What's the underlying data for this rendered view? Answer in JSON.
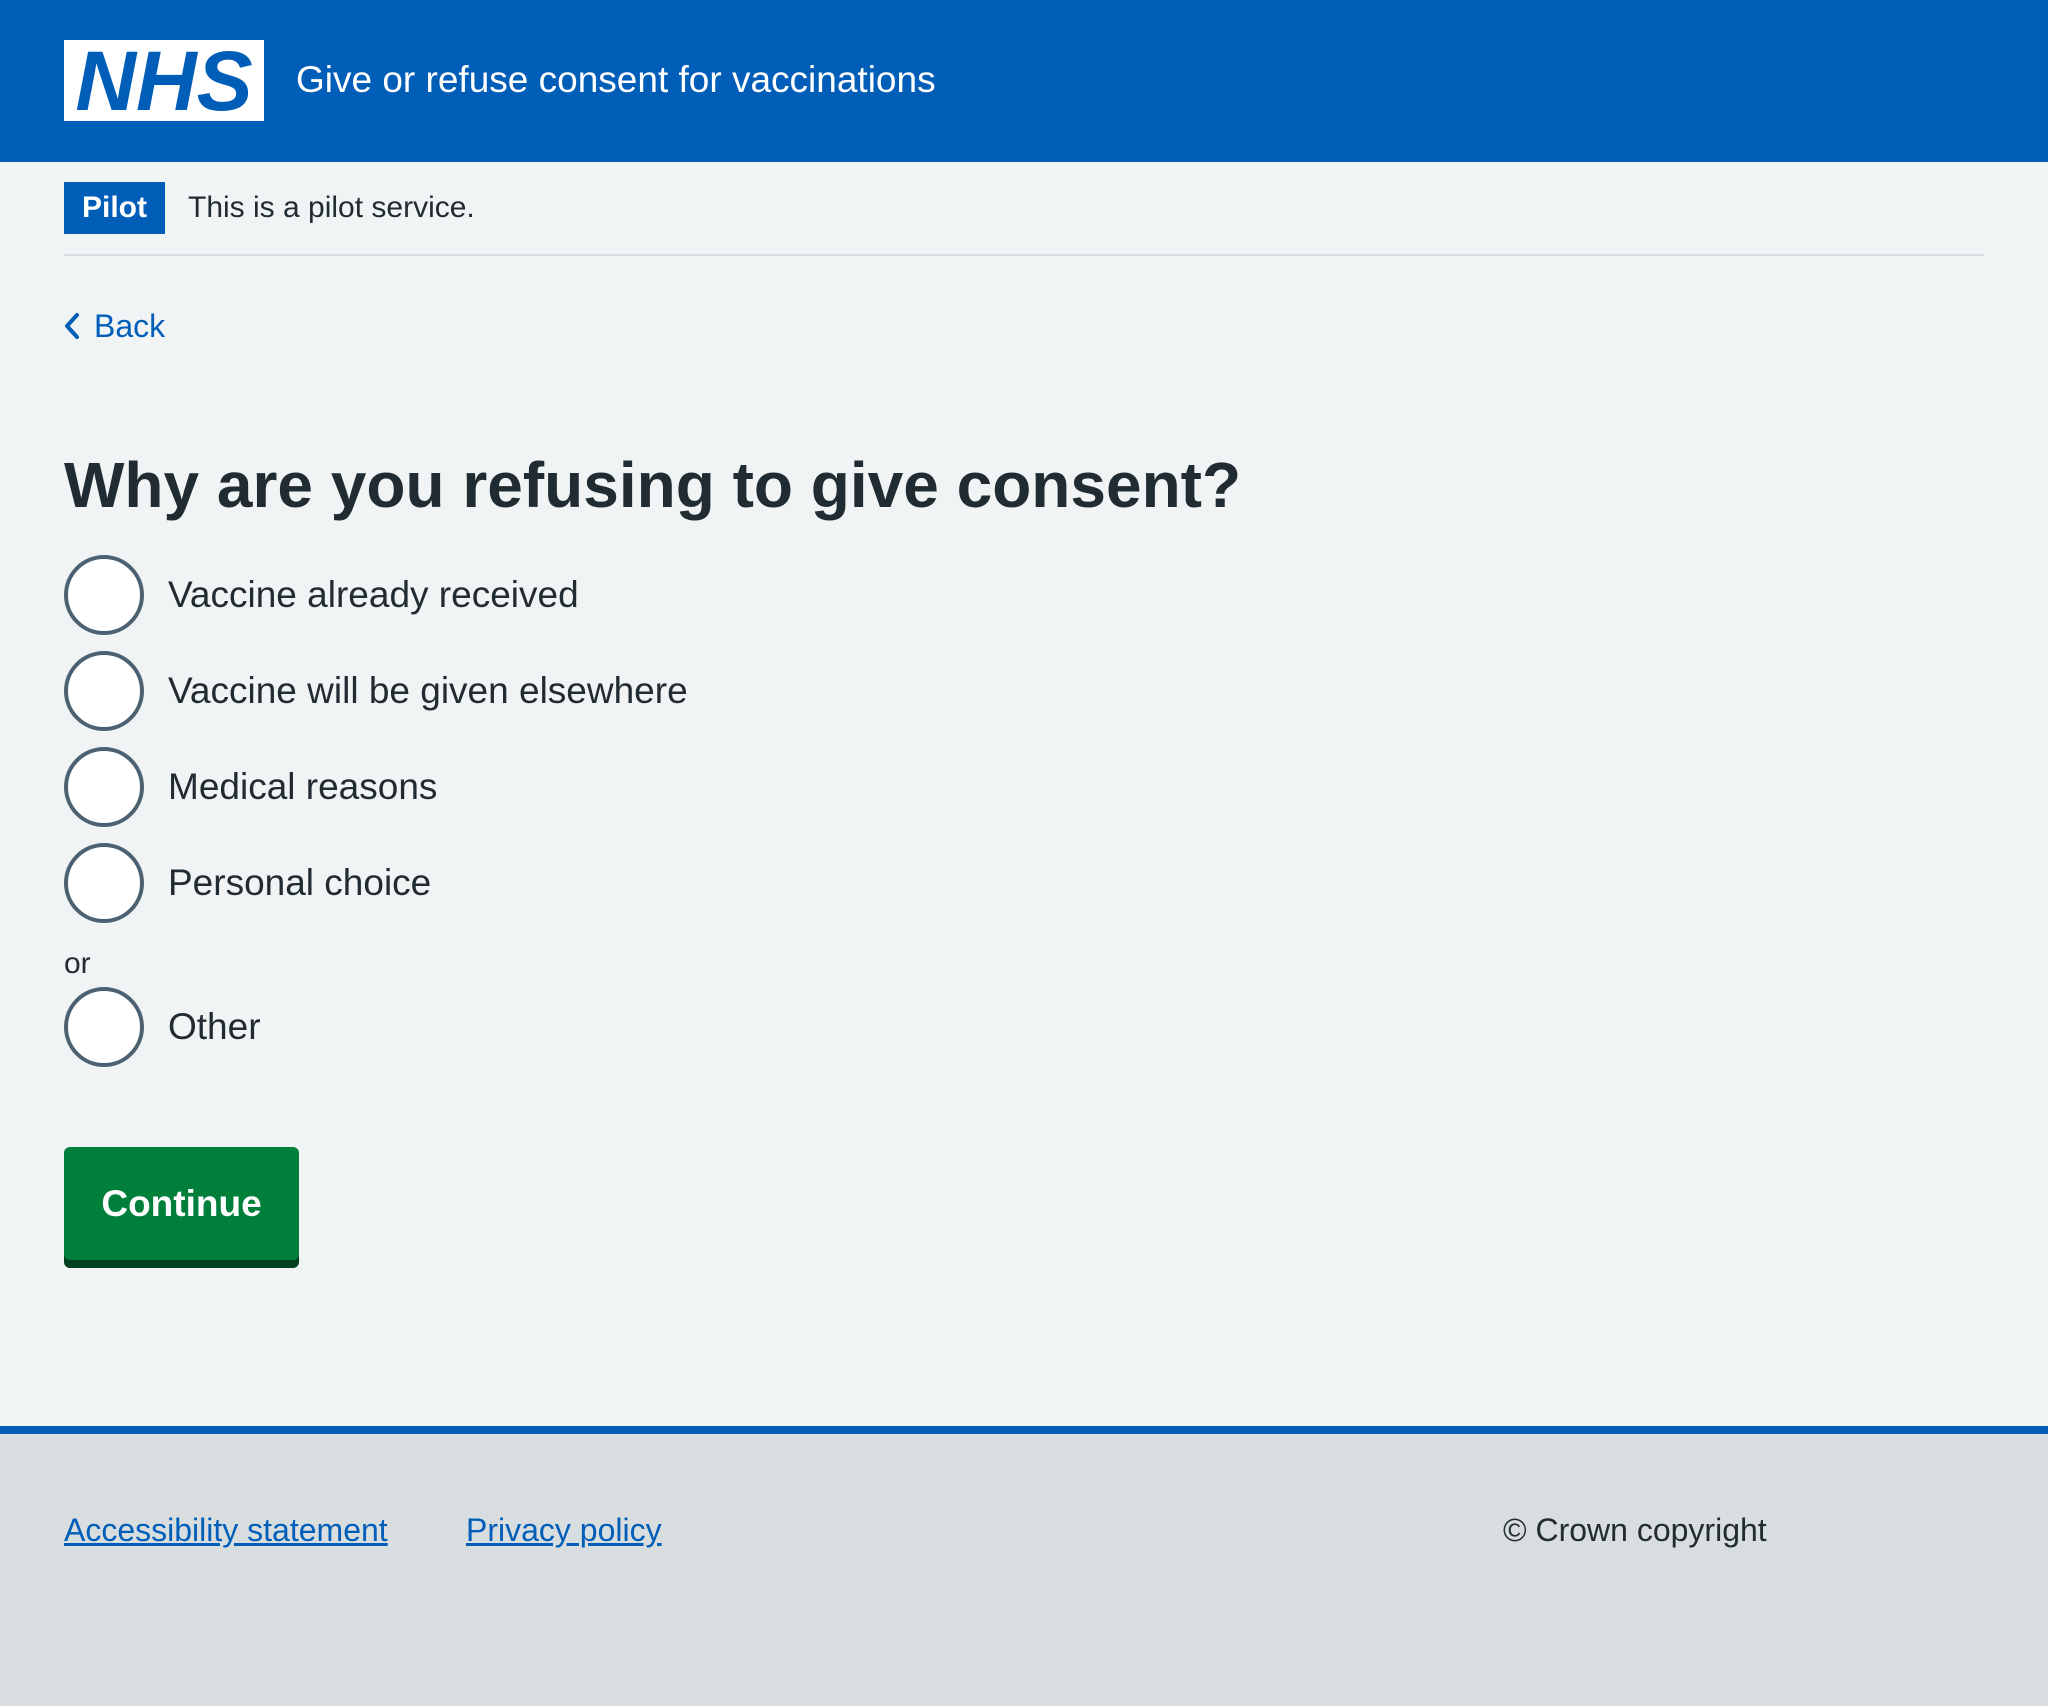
{
  "header": {
    "logo_text": "NHS",
    "service_name": "Give or refuse consent for vaccinations",
    "colors": {
      "nhs_blue": "#005eb8"
    }
  },
  "phase_banner": {
    "tag": "Pilot",
    "text": "This is a pilot service."
  },
  "back_link": {
    "label": "Back",
    "icon": "chevron-left-icon"
  },
  "question": {
    "title": "Why are you refusing to give consent?",
    "options": [
      {
        "label": "Vaccine already received",
        "selected": false
      },
      {
        "label": "Vaccine will be given elsewhere",
        "selected": false
      },
      {
        "label": "Medical reasons",
        "selected": false
      },
      {
        "label": "Personal choice",
        "selected": false
      }
    ],
    "divider": "or",
    "other_option": {
      "label": "Other",
      "selected": false
    }
  },
  "continue_button": {
    "label": "Continue",
    "color": "#007f3b"
  },
  "footer": {
    "links": [
      "Accessibility statement",
      "Privacy policy"
    ],
    "copyright": "© Crown copyright"
  }
}
